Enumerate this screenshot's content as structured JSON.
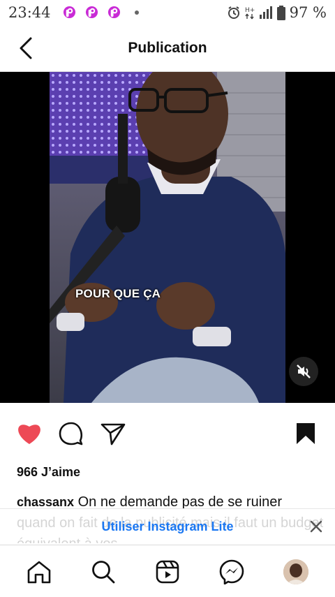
{
  "status_bar": {
    "time": "23:44",
    "battery_percent": "97 %",
    "network_label": "H+",
    "notification_app_icons": [
      "picsart-icon",
      "picsart-icon",
      "picsart-icon"
    ]
  },
  "header": {
    "title": "Publication",
    "back_icon": "chevron-left-icon"
  },
  "media": {
    "overlay_caption": "POUR QUE ÇA",
    "sound_state": "muted",
    "mute_icon": "speaker-muted-icon"
  },
  "actions": {
    "liked": true,
    "like_color": "#ed4956",
    "icons": [
      "heart-icon",
      "comment-icon",
      "share-icon",
      "bookmark-icon"
    ]
  },
  "post": {
    "likes_text": "966 J’aime",
    "username": "chassanx",
    "caption_text": "On ne demande pas de se ruiner quand on fait de la publicité mais il faut un budget équivalent à vos"
  },
  "lite_banner": {
    "label": "Utiliser Instagram Lite",
    "link_color": "#1a77f2",
    "close_icon": "close-icon"
  },
  "bottom_nav": {
    "items": [
      "home-icon",
      "search-icon",
      "reels-icon",
      "messenger-icon",
      "profile-avatar"
    ]
  }
}
